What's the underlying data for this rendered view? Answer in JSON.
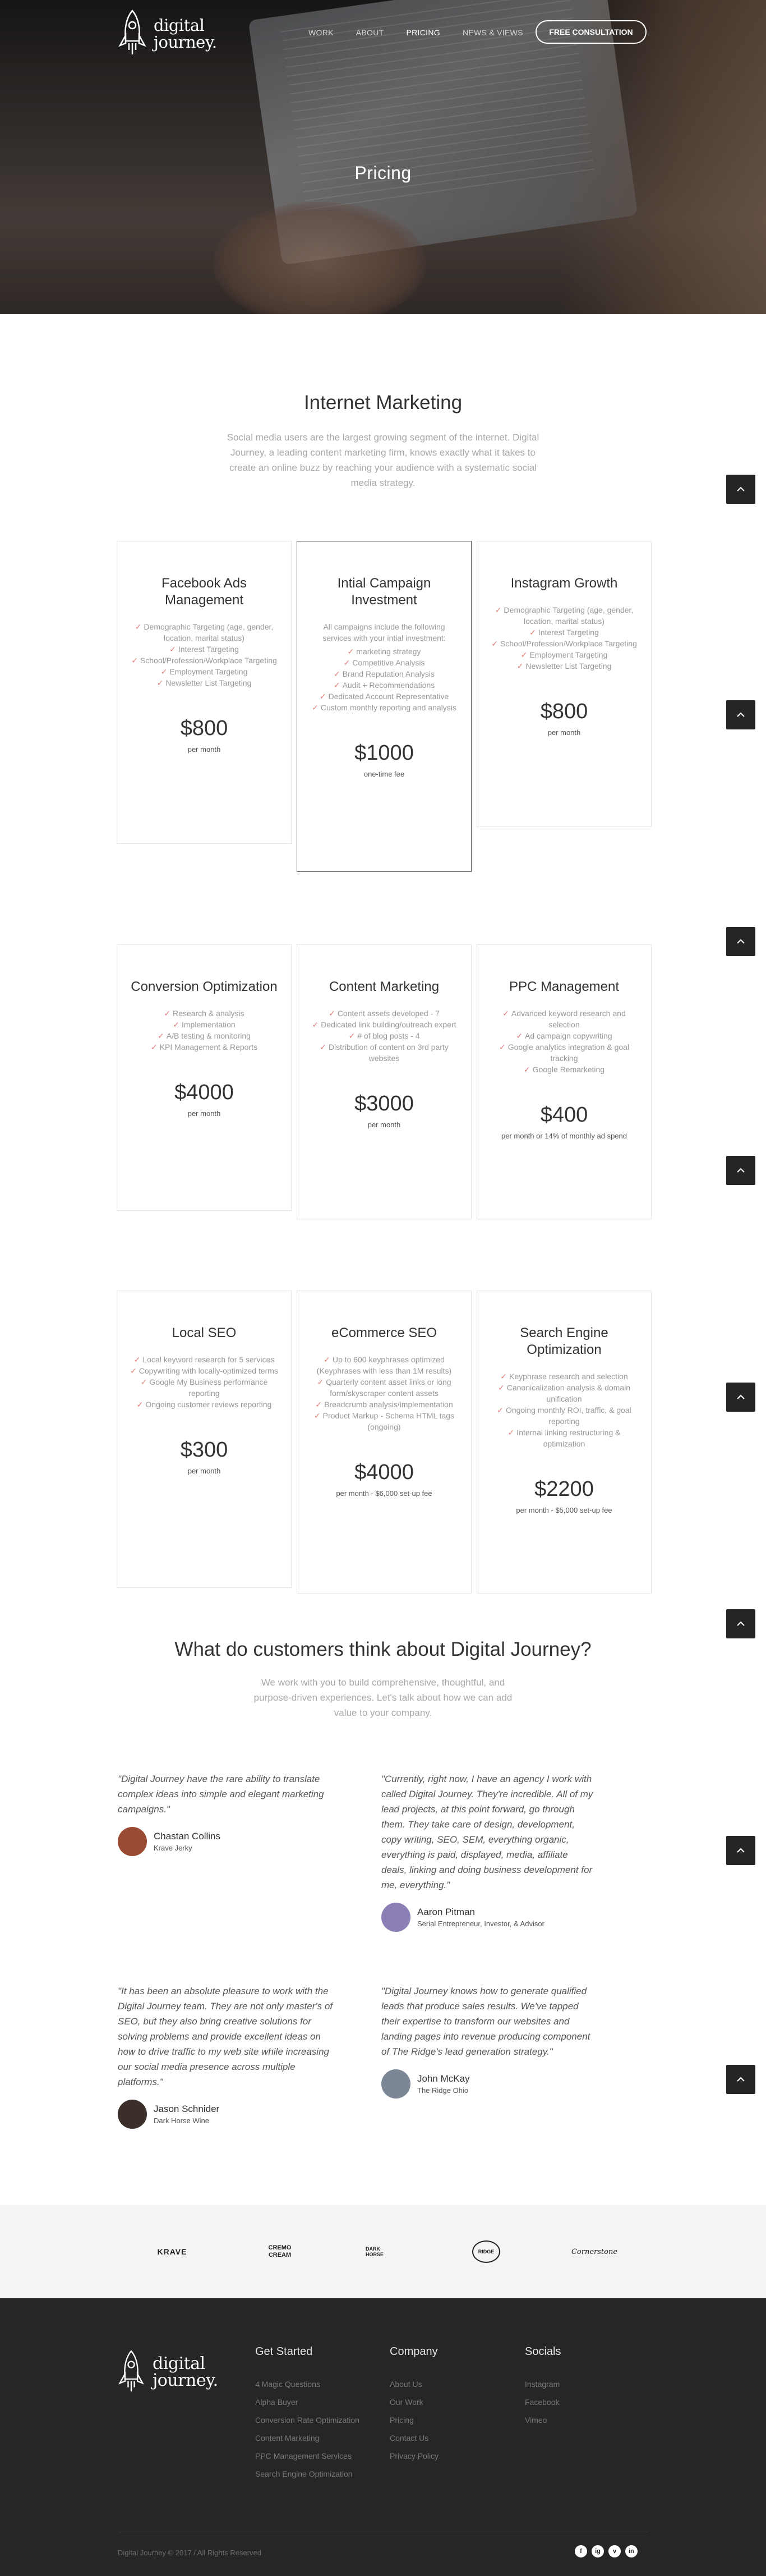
{
  "brand": {
    "line1": "digital",
    "line2": "journey."
  },
  "nav": {
    "items": [
      {
        "label": "Work"
      },
      {
        "label": "About"
      },
      {
        "label": "Pricing"
      },
      {
        "label": "News & Views"
      }
    ],
    "active": "Pricing",
    "cta": "Free Consultation"
  },
  "hero": {
    "title": "Pricing"
  },
  "internet": {
    "title": "Internet Marketing",
    "lead": "Social media users are the largest growing segment of the internet. Digital Journey, a leading content marketing firm, knows exactly what it takes to create an online buzz by reaching your audience with a systematic social media strategy."
  },
  "plans": [
    {
      "title": "Facebook Ads Management",
      "desc": "",
      "features": [
        "Demographic Targeting (age, gender, location, marital status)",
        "Interest Targeting",
        "School/Profession/Workplace Targeting",
        "Employment Targeting",
        "Newsletter List Targeting"
      ],
      "price": "$800",
      "note": "per month"
    },
    {
      "title": "Intial Campaign Investment",
      "desc": "All campaigns include the following services with your intial investment:",
      "features": [
        "marketing strategy",
        "Competitive Analysis",
        "Brand Reputation Analysis",
        "Audit + Recommendations",
        "Dedicated Account Representative",
        "Custom monthly reporting and analysis"
      ],
      "price": "$1000",
      "note": "one-time fee"
    },
    {
      "title": "Instagram Growth",
      "desc": "",
      "features": [
        "Demographic Targeting (age, gender, location, marital status)",
        "Interest Targeting",
        "School/Profession/Workplace Targeting",
        "Employment Targeting",
        "Newsletter List Targeting"
      ],
      "price": "$800",
      "note": "per month"
    },
    {
      "title": "Conversion Optimization",
      "desc": "",
      "features": [
        "Research & analysis",
        "Implementation",
        "A/B testing & monitoring",
        "KPI Management & Reports"
      ],
      "price": "$4000",
      "note": "per month"
    },
    {
      "title": "Content Marketing",
      "desc": "",
      "features": [
        "Content assets developed - 7",
        "Dedicated link building/outreach expert",
        "# of blog posts - 4",
        "Distribution of content on 3rd party websites"
      ],
      "price": "$3000",
      "note": "per month"
    },
    {
      "title": "PPC Management",
      "desc": "",
      "features": [
        "Advanced keyword research and selection",
        "Ad campaign copywriting",
        "Google analytics integration & goal tracking",
        "Google Remarketing"
      ],
      "price": "$400",
      "note": "per month or 14% of monthly ad spend"
    },
    {
      "title": "Local SEO",
      "desc": "",
      "features": [
        "Local keyword research for 5 services",
        "Copywriting with locally-optimized terms",
        "Google My Business performance reporting",
        "Ongoing customer reviews reporting"
      ],
      "price": "$300",
      "note": "per month"
    },
    {
      "title": "eCommerce SEO",
      "desc": "",
      "features": [
        "Up to 600 keyphrases optimized (Keyphrases with less than 1M results)",
        "Quarterly content asset links or long form/skyscraper content assets",
        "Breadcrumb analysis/implementation",
        "Product Markup - Schema HTML tags (ongoing)"
      ],
      "price": "$4000",
      "note": "per month - $6,000 set-up fee"
    },
    {
      "title": "Search Engine Optimization",
      "desc": "",
      "features": [
        "Keyphrase research and selection",
        "Canonicalization analysis & domain unification",
        "Ongoing monthly ROI, traffic, & goal reporting",
        "Internal linking restructuring & optimization"
      ],
      "price": "$2200",
      "note": "per month - $5,000 set-up fee"
    }
  ],
  "testimonials": {
    "title": "What do customers think about Digital Journey?",
    "lead": "We work with you to build comprehensive, thoughtful, and purpose-driven experiences. Let's talk about how we can add value to your company.",
    "items": [
      {
        "quote": "\"Digital Journey have the rare ability to translate complex ideas into simple and elegant marketing campaigns.\"",
        "name": "Chastan Collins",
        "role": "Krave Jerky",
        "avatar_color": "#9a4b34"
      },
      {
        "quote": "\"Currently, right now, I have an agency I work with called Digital Journey. They're incredible. All of my lead projects, at this point forward, go through them. They take care of design, development, copy writing, SEO, SEM, everything organic, everything is paid, displayed, media, affiliate deals, linking and doing business development for me, everything.\"",
        "name": "Aaron Pitman",
        "role": "Serial Entrepreneur, Investor, & Advisor",
        "avatar_color": "#8c7fb5"
      },
      {
        "quote": "\"It has been an absolute pleasure to work with the Digital Journey team. They are not only master's of SEO, but they also bring creative solutions for solving problems and provide excellent ideas on how to drive traffic to my web site while increasing our social media presence across multiple platforms.\"",
        "name": "Jason Schnider",
        "role": "Dark Horse Wine",
        "avatar_color": "#3a2f2a"
      },
      {
        "quote": "\"Digital Journey knows how to generate qualified leads that produce sales results. We've tapped their expertise to transform our websites and landing pages into revenue producing component of The Ridge's lead generation strategy.\"",
        "name": "John McKay",
        "role": "The Ridge Ohio",
        "avatar_color": "#7b8794"
      }
    ]
  },
  "clients": [
    {
      "label": "KRAVE"
    },
    {
      "label": "CREMO CREAM"
    },
    {
      "label": "DARK HORSE"
    },
    {
      "label": "RIDGE"
    },
    {
      "label": "Cornerstone"
    }
  ],
  "footer": {
    "cols": [
      {
        "title": "Get Started",
        "links": [
          "4 Magic Questions",
          "Alpha Buyer",
          "Conversion Rate Optimization",
          "Content Marketing",
          "PPC Management Services",
          "Search Engine Optimization"
        ]
      },
      {
        "title": "Company",
        "links": [
          "About Us",
          "Our Work",
          "Pricing",
          "Contact Us",
          "Privacy Policy"
        ]
      },
      {
        "title": "Socials",
        "links": [
          "Instagram",
          "Facebook",
          "Vimeo"
        ]
      }
    ],
    "copyright": "Digital Journey © 2017 / All Rights Reserved",
    "socials": [
      {
        "label": "f"
      },
      {
        "label": "ig"
      },
      {
        "label": "v"
      },
      {
        "label": "in"
      }
    ]
  },
  "ui": {
    "totop_icon": "chevron-up-icon",
    "check_icon": "check-icon",
    "accent": "#e07a76",
    "footer_bg": "#262626"
  }
}
